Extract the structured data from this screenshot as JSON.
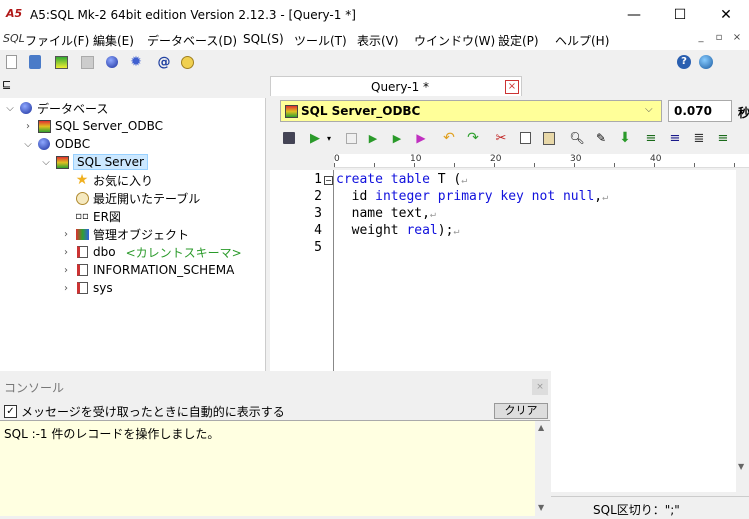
{
  "window": {
    "title": "A5:SQL Mk-2 64bit edition Version 2.12.3 - [Query-1 *]",
    "app_icon": "A5",
    "minimize": "—",
    "maximize": "☐",
    "close": "✕"
  },
  "menu": {
    "logo": "SQL",
    "items": [
      "ファイル(F)",
      "編集(E)",
      "データベース(D)",
      "SQL(S)",
      "ツール(T)",
      "表示(V)",
      "ウインドウ(W)",
      "設定(P)",
      "ヘルプ(H)"
    ],
    "mdi_minimize": "_",
    "mdi_restore": "▫",
    "mdi_close": "×"
  },
  "tree": {
    "root": "データベース",
    "nodes": [
      {
        "label": "SQL Server_ODBC"
      },
      {
        "label": "ODBC"
      },
      {
        "label": "SQL Server"
      },
      {
        "label": "お気に入り"
      },
      {
        "label": "最近開いたテーブル"
      },
      {
        "label": "ER図"
      },
      {
        "label": "管理オブジェクト"
      },
      {
        "label": "dbo",
        "suffix": "<カレントスキーマ>"
      },
      {
        "label": "INFORMATION_SCHEMA"
      },
      {
        "label": "sys"
      }
    ]
  },
  "editor": {
    "tab_label": "Query-1 *",
    "tab_close": "×",
    "connection": "SQL Server_ODBC",
    "time": "0.070",
    "time_unit": "秒",
    "ruler": [
      "0",
      "10",
      "20",
      "30",
      "40"
    ],
    "lines": [
      {
        "num": "1",
        "text": ""
      },
      {
        "num": "2",
        "text": ""
      },
      {
        "num": "3",
        "text": ""
      },
      {
        "num": "4",
        "text": ""
      },
      {
        "num": "5",
        "text": ""
      }
    ],
    "code": {
      "l1_kw": "create table",
      "l1_rest": " T (",
      "l2_pre": "  id ",
      "l2_kw": "integer primary key not null",
      "l2_rest": ",",
      "l3": "  name text,",
      "l4_pre": "  weight ",
      "l4_kw": "real",
      "l4_rest": ");"
    },
    "return_mark": "↵"
  },
  "console": {
    "title": "コンソール",
    "auto_show_label": "メッセージを受け取ったときに自動的に表示する",
    "auto_show_checked": "✓",
    "clear_button": "クリア",
    "output": "SQL  :-1 件のレコードを操作しました。"
  },
  "status": {
    "separator": "SQL区切り：\";\""
  }
}
